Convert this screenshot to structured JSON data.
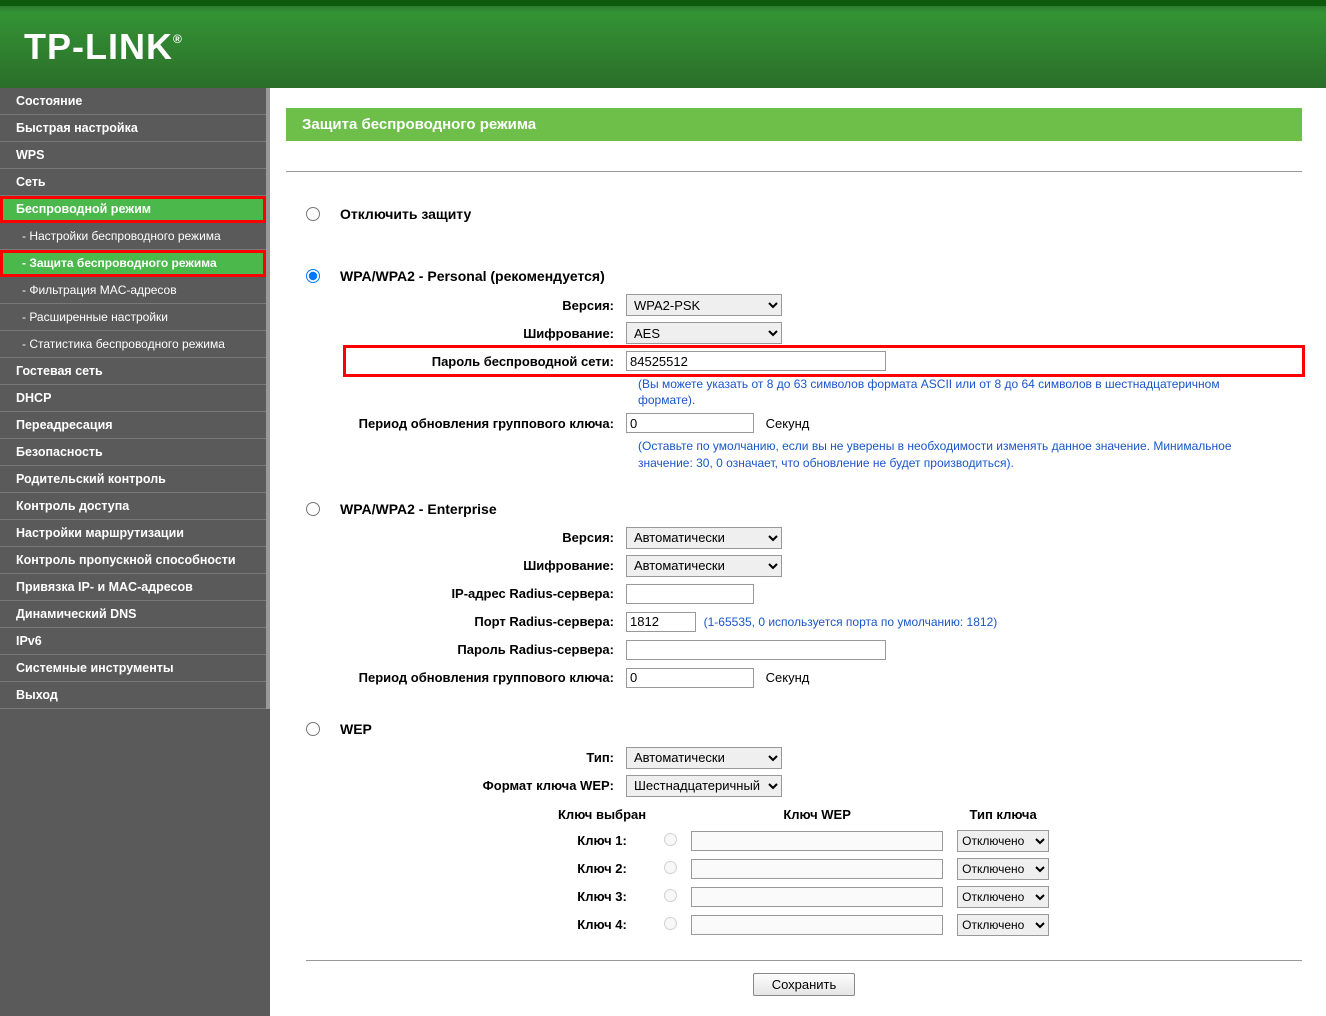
{
  "logo": "TP-LINK",
  "sidebar": {
    "items": [
      {
        "label": "Состояние"
      },
      {
        "label": "Быстрая настройка"
      },
      {
        "label": "WPS"
      },
      {
        "label": "Сеть"
      },
      {
        "label": "Беспроводной режим",
        "active": true,
        "highlight": true
      },
      {
        "label": "- Настройки беспроводного режима",
        "sub": true
      },
      {
        "label": "- Защита беспроводного режима",
        "sub": true,
        "active": true,
        "highlight": true
      },
      {
        "label": "- Фильтрация MAC-адресов",
        "sub": true
      },
      {
        "label": "- Расширенные настройки",
        "sub": true
      },
      {
        "label": "- Статистика беспроводного режима",
        "sub": true
      },
      {
        "label": "Гостевая сеть"
      },
      {
        "label": "DHCP"
      },
      {
        "label": "Переадресация"
      },
      {
        "label": "Безопасность"
      },
      {
        "label": "Родительский контроль"
      },
      {
        "label": "Контроль доступа"
      },
      {
        "label": "Настройки маршрутизации"
      },
      {
        "label": "Контроль пропускной способности"
      },
      {
        "label": "Привязка IP- и MAC-адресов"
      },
      {
        "label": "Динамический DNS"
      },
      {
        "label": "IPv6"
      },
      {
        "label": "Системные инструменты"
      },
      {
        "label": "Выход"
      }
    ]
  },
  "page": {
    "title": "Защита беспроводного режима",
    "disable_label": "Отключить защиту",
    "save": "Сохранить"
  },
  "wpa_personal": {
    "title": "WPA/WPA2 - Personal (рекомендуется)",
    "version_label": "Версия:",
    "version_value": "WPA2-PSK",
    "encryption_label": "Шифрование:",
    "encryption_value": "AES",
    "password_label": "Пароль беспроводной сети:",
    "password_value": "84525512",
    "password_note": "(Вы можете указать от 8 до 63 символов формата ASCII или от 8 до 64 символов в шестнадцатеричном формате).",
    "gku_label": "Период обновления группового ключа:",
    "gku_value": "0",
    "gku_unit": "Секунд",
    "gku_note": "(Оставьте по умолчанию, если вы не уверены в необходимости изменять данное значение. Минимальное значение: 30, 0 означает, что обновление не будет производиться)."
  },
  "wpa_enterprise": {
    "title": "WPA/WPA2 - Enterprise",
    "version_label": "Версия:",
    "version_value": "Автоматически",
    "encryption_label": "Шифрование:",
    "encryption_value": "Автоматически",
    "radius_ip_label": "IP-адрес Radius-сервера:",
    "radius_ip_value": "",
    "radius_port_label": "Порт Radius-сервера:",
    "radius_port_value": "1812",
    "radius_port_note": "(1-65535, 0 используется порта по умолчанию: 1812)",
    "radius_pw_label": "Пароль Radius-сервера:",
    "radius_pw_value": "",
    "gku_label": "Период обновления группового ключа:",
    "gku_value": "0",
    "gku_unit": "Секунд"
  },
  "wep": {
    "title": "WEP",
    "type_label": "Тип:",
    "type_value": "Автоматически",
    "format_label": "Формат ключа WEP:",
    "format_value": "Шестнадцатеричный",
    "col_selected": "Ключ выбран",
    "col_wep": "Ключ WEP",
    "col_type": "Тип ключа",
    "keys": [
      {
        "label": "Ключ 1:",
        "type": "Отключено"
      },
      {
        "label": "Ключ 2:",
        "type": "Отключено"
      },
      {
        "label": "Ключ 3:",
        "type": "Отключено"
      },
      {
        "label": "Ключ 4:",
        "type": "Отключено"
      }
    ]
  }
}
